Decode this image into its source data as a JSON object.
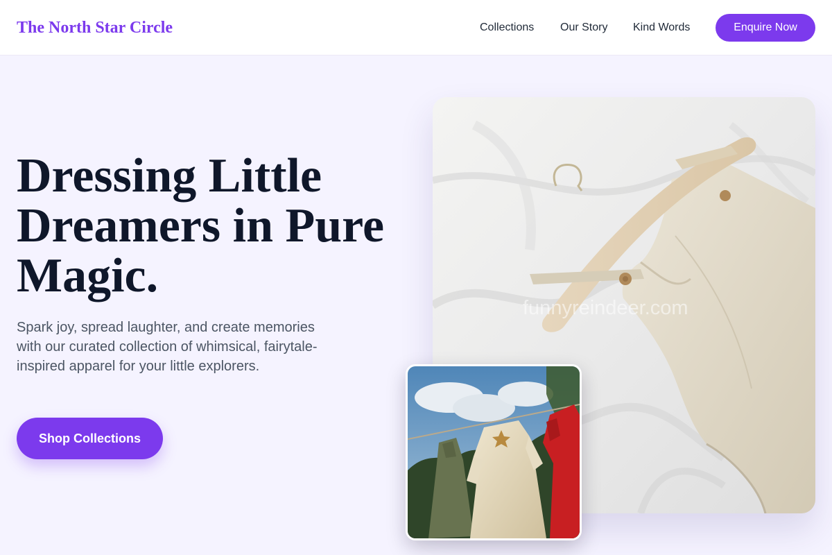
{
  "header": {
    "brand": "The North Star Circle",
    "nav": [
      "Collections",
      "Our Story",
      "Kind Words"
    ],
    "cta_label": "Enquire Now"
  },
  "hero": {
    "title": "Dressing Little Dreamers in Pure Magic.",
    "subtitle": "Spark joy, spread laughter, and create memories with our curated collection of whimsical, fairytale-inspired apparel for your little explorers.",
    "cta_label": "Shop Collections"
  },
  "images": {
    "main": {
      "watermark": "funnyreindeer.com"
    }
  },
  "colors": {
    "brand": "#7c3aed",
    "background": "#f5f3ff",
    "heading": "#0f172a",
    "body_text": "#4b5563"
  }
}
